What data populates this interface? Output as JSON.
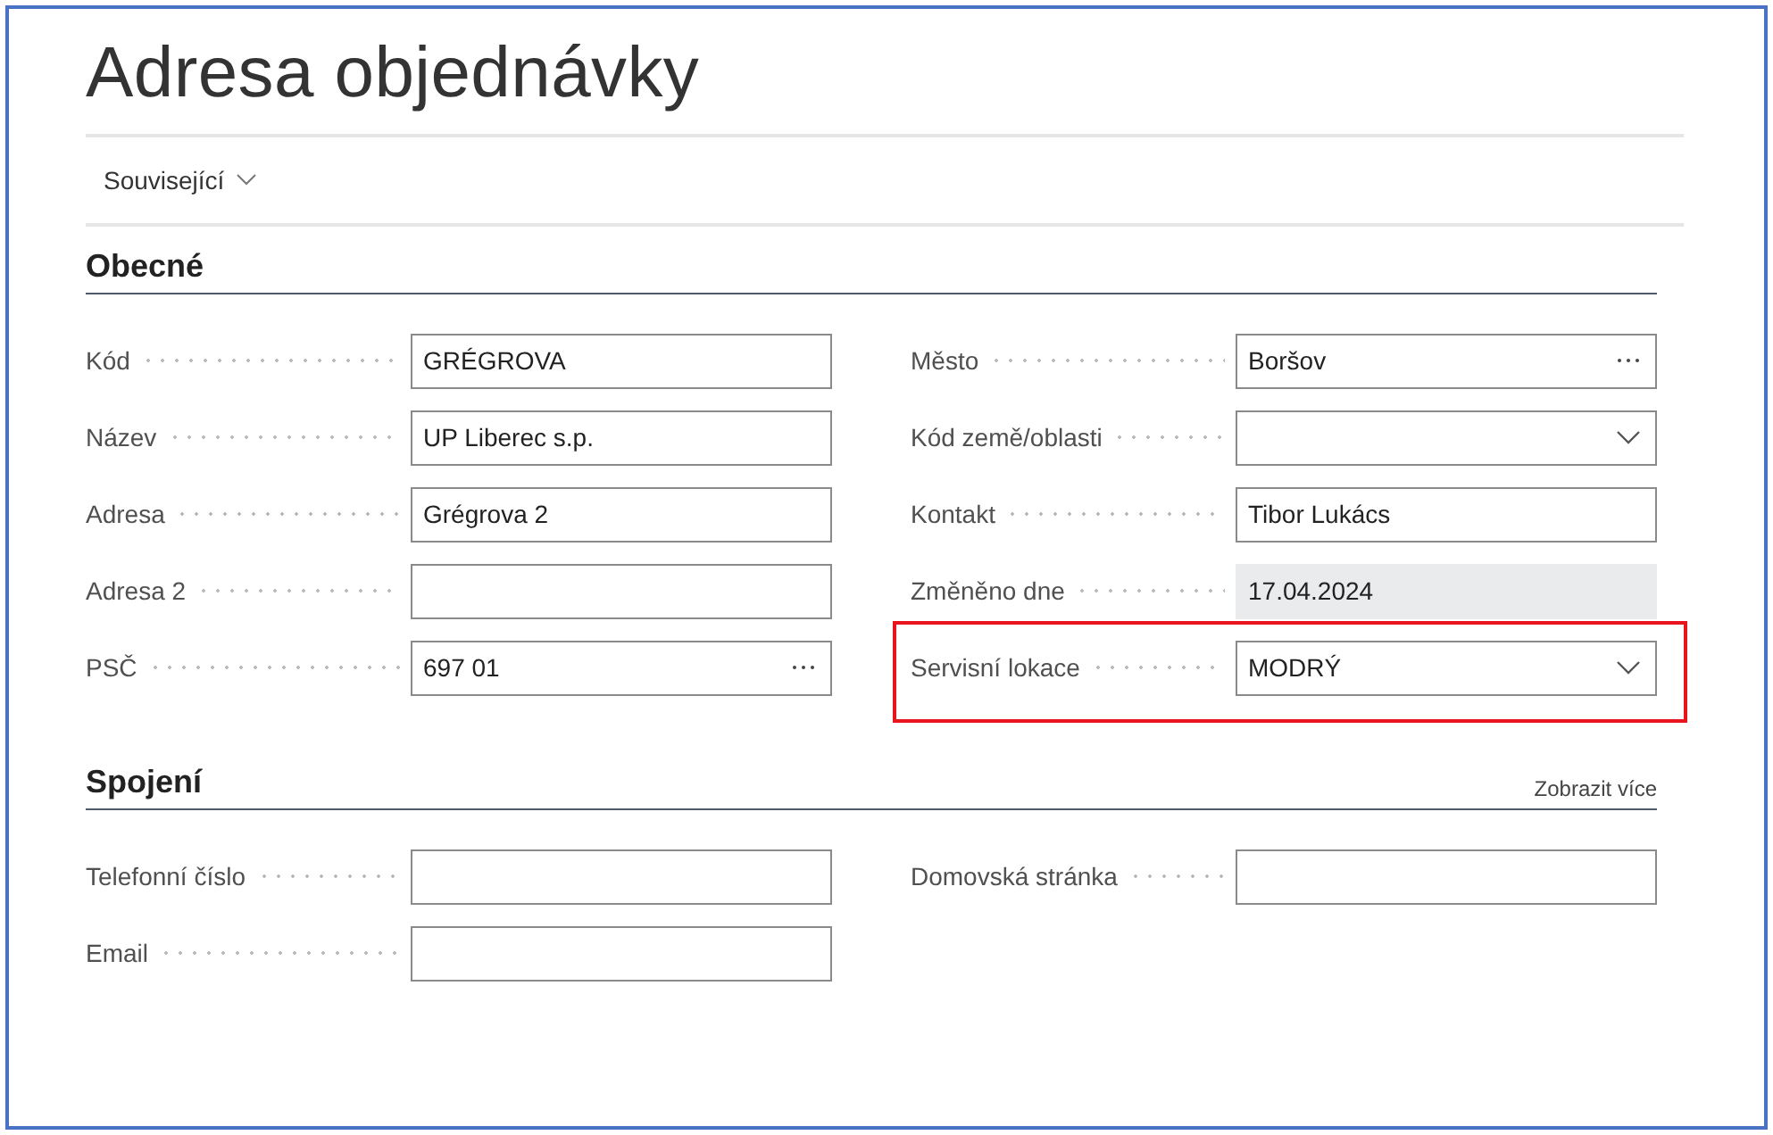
{
  "page": {
    "title": "Adresa objednávky"
  },
  "action_bar": {
    "items": [
      {
        "label": "Související",
        "kind": "menu"
      }
    ]
  },
  "sections": [
    {
      "title": "Obecné",
      "columns": [
        [
          {
            "label": "Kód",
            "kind": "text",
            "value": "GRÉGROVA",
            "highlighted": false
          },
          {
            "label": "Název",
            "kind": "text",
            "value": "UP Liberec s.p.",
            "highlighted": false
          },
          {
            "label": "Adresa",
            "kind": "text",
            "value": "Grégrova 2",
            "highlighted": false
          },
          {
            "label": "Adresa 2",
            "kind": "text",
            "highlighted": false
          },
          {
            "label": "PSČ",
            "kind": "lookup",
            "value": "697 01",
            "highlighted": false
          }
        ],
        [
          {
            "label": "Město",
            "kind": "lookup",
            "value": "Boršov",
            "highlighted": false
          },
          {
            "label": "Kód země/oblasti",
            "kind": "dropdown",
            "highlighted": false
          },
          {
            "label": "Kontakt",
            "kind": "text",
            "value": "Tibor Lukács",
            "highlighted": false
          },
          {
            "label": "Změněno dne",
            "kind": "readonly",
            "value": "17.04.2024",
            "highlighted": false
          },
          {
            "label": "Servisní lokace",
            "kind": "dropdown",
            "value": "MODRÝ",
            "highlighted": true
          }
        ]
      ]
    },
    {
      "title": "Spojení",
      "show_more": "Zobrazit více",
      "columns": [
        [
          {
            "label": "Telefonní číslo",
            "kind": "text",
            "highlighted": false
          },
          {
            "label": "Email",
            "kind": "text",
            "highlighted": false
          }
        ],
        [
          {
            "label": "Domovská stránka",
            "kind": "text",
            "highlighted": false
          }
        ]
      ]
    }
  ]
}
